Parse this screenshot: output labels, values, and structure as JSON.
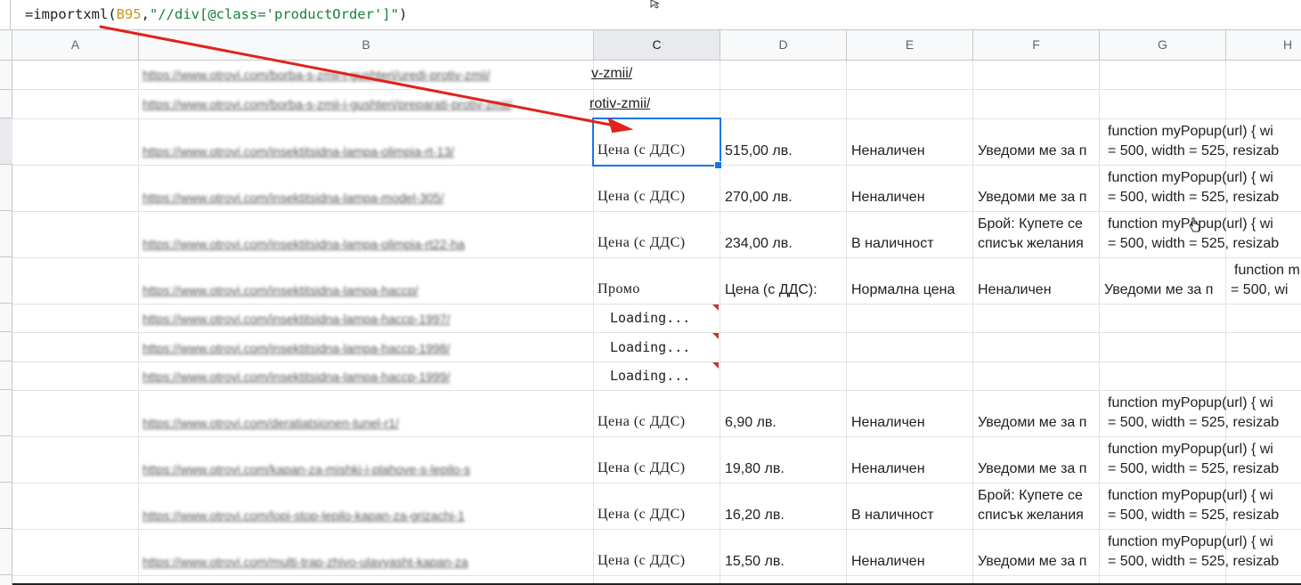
{
  "formula": {
    "prefix": "=importxml(",
    "ref": "B95",
    "sep": ",",
    "xpath": "\"//div[@class='productOrder']\"",
    "suffix": ")"
  },
  "columns": [
    "A",
    "B",
    "C",
    "D",
    "E",
    "F",
    "G",
    "H"
  ],
  "rows": [
    {
      "b": "https://www.otrovi.com/borba-s-zmii-i-gushteri/uredi-protiv-zmii/",
      "c_link": "v-zmii/"
    },
    {
      "b": "https://www.otrovi.com/borba-s-zmii-i-gushteri/preparati-protiv-zmii/",
      "c_link": "rotiv-zmii/"
    },
    {
      "b": "https://www.otrovi.com/insektitsidna-lampa-olimpia-rt-13/",
      "c": "Цена (с ДДС)",
      "d": "515,00 лв.",
      "e": "Неналичен",
      "f": "Уведоми ме за п",
      "g1": "function myPopup(url) { wi",
      "g2": "= 500, width = 525, resizab"
    },
    {
      "b": "https://www.otrovi.com/insektitsidna-lampa-model-305/",
      "c": "Цена (с ДДС)",
      "d": "270,00 лв.",
      "e": "Неналичен",
      "f": "Уведоми ме за п",
      "g1": "function myPopup(url) { wi",
      "g2": "= 500, width = 525, resizab"
    },
    {
      "b": "https://www.otrovi.com/insektitsidna-lampa-olimpia-rt22-ha",
      "c": "Цена (с ДДС)",
      "d": "234,00 лв.",
      "e": "В наличност",
      "f1": "Брой: Купете се",
      "f2": "списък желания",
      "g1": "function myPopup(url) { wi",
      "g2": "= 500, width = 525, resizab"
    },
    {
      "b": "https://www.otrovi.com/insektitsidna-lampa-haccp/",
      "c": "Промо",
      "d": "Цена (с ДДС):",
      "e": "Нормална цена",
      "f": "Неналичен",
      "g": "Уведоми ме за п",
      "h1": "function m",
      "h2": "= 500, wi"
    },
    {
      "b": "https://www.otrovi.com/insektitsidna-lampa-haccp-1997/",
      "c": "Loading..."
    },
    {
      "b": "https://www.otrovi.com/insektitsidna-lampa-haccp-1998/",
      "c": "Loading..."
    },
    {
      "b": "https://www.otrovi.com/insektitsidna-lampa-haccp-1999/",
      "c": "Loading..."
    },
    {
      "b": "https://www.otrovi.com/deratiatsionen-tunel-r1/",
      "c": "Цена (с ДДС)",
      "d": "6,90 лв.",
      "e": "Неналичен",
      "f": "Уведоми ме за п",
      "g1": "function myPopup(url) { wi",
      "g2": "= 500, width = 525, resizab"
    },
    {
      "b": "https://www.otrovi.com/kapan-za-mishki-i-plahove-s-lepilo-s",
      "c": "Цена (с ДДС)",
      "d": "19,80 лв.",
      "e": "Неналичен",
      "f": "Уведоми ме за п",
      "g1": "function myPopup(url) { wi",
      "g2": "= 500, width = 525, resizab"
    },
    {
      "b": "https://www.otrovi.com/lopi-stop-lepilo-kapan-za-grizachi-1",
      "c": "Цена (с ДДС)",
      "d": "16,20 лв.",
      "e": "В наличност",
      "f1": "Брой: Купете се",
      "f2": "списък желания",
      "g1": "function myPopup(url) { wi",
      "g2": "= 500, width = 525, resizab"
    },
    {
      "b": "https://www.otrovi.com/multi-trap-zhivo-ulavyasht-kapan-za",
      "c": "Цена (с ДДС)",
      "d": "15,50 лв.",
      "e": "Неналичен",
      "f": "Уведоми ме за п",
      "g1": "function myPopup(url) { wi",
      "g2": "= 500, width = 525, resizab"
    }
  ],
  "colors": {
    "selection": "#1a73e8",
    "arrow": "#e0231b",
    "note_marker": "#b93a32"
  }
}
